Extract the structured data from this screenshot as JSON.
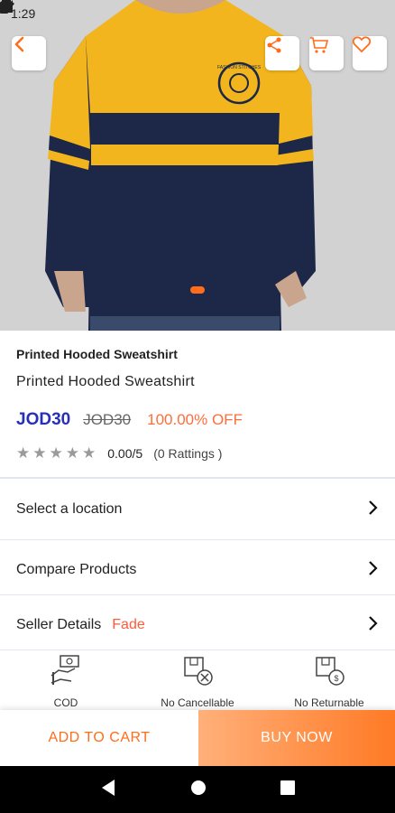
{
  "status_bar": {
    "time": "1:29"
  },
  "product": {
    "brand": "Printed Hooded Sweatshirt",
    "name": "Printed Hooded Sweatshirt",
    "price": "JOD30",
    "mrp": "JOD30",
    "discount": "100.00% OFF",
    "rating_value": "0.00/5",
    "rating_count": "(0  Rattings )",
    "stars": 0,
    "image_tag": "FASHION STITCHES"
  },
  "rows": {
    "location": "Select a location",
    "compare": "Compare Products",
    "seller_label": "Seller Details",
    "seller_name": "Fade"
  },
  "policies": [
    {
      "label": "COD",
      "icon": "cod-icon"
    },
    {
      "label": "No Cancellable",
      "icon": "no-cancel-icon"
    },
    {
      "label": "No Returnable",
      "icon": "no-return-icon"
    }
  ],
  "actions": {
    "add_to_cart": "ADD TO CART",
    "buy_now": "BUY NOW"
  },
  "colors": {
    "accent": "#ff6d1a",
    "price": "#2630b8",
    "discount": "#ff6d3a",
    "seller": "#ff5a3a"
  }
}
